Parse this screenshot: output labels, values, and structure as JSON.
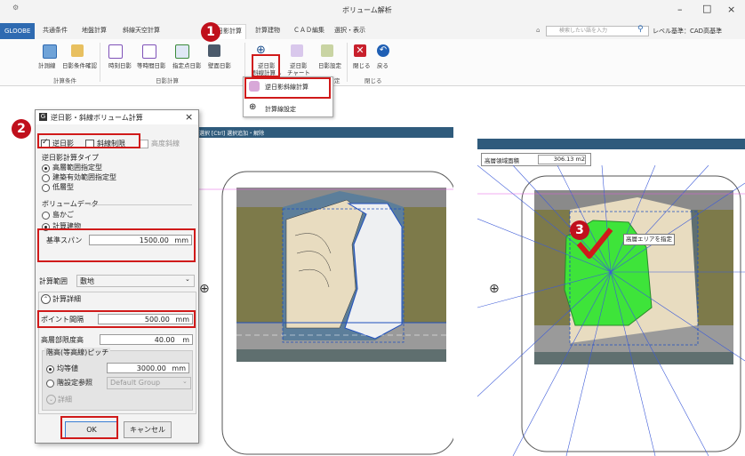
{
  "window": {
    "title": "ボリューム解析",
    "minimize": "–",
    "maximize": "□",
    "close": "×"
  },
  "tabs": [
    "GLOOBE",
    "共通条件",
    "地盤計算",
    "斜線天空計算",
    "日影計算",
    "計算建物",
    "ＣＡＤ編集",
    "選択・表示"
  ],
  "search": {
    "placeholder": "検索したい語を入力"
  },
  "level_label": "レベル基準：CAD高基準",
  "ribbon": {
    "buttons": [
      {
        "label": "計測線",
        "sub": "⌄"
      },
      {
        "label": "日影条件確認",
        "sub": ""
      },
      {
        "label": "時刻日影",
        "sub": ""
      },
      {
        "label": "等時間日影",
        "sub": ""
      },
      {
        "label": "指定点日影",
        "sub": ""
      },
      {
        "label": "壁面日影",
        "sub": "⌄"
      },
      {
        "label": "逆日影",
        "sub": "斜線計算 ⌄"
      },
      {
        "label": "逆日影",
        "sub": "チャート"
      },
      {
        "label": "日影設定",
        "sub": ""
      },
      {
        "label": "閉じる",
        "sub": ""
      },
      {
        "label": "戻る",
        "sub": ""
      }
    ],
    "groups": [
      "計算条件",
      "日影計算",
      "定",
      "閉じる"
    ]
  },
  "dropdown": {
    "items": [
      "逆日影斜線計算",
      "計算線設定"
    ]
  },
  "canvas_hint": "選択 [Ctrl] 選択追加・解除",
  "area_readout": {
    "label": "高層領域面積",
    "value": "306.13",
    "unit": "m2"
  },
  "callout": "高層エリアを指定",
  "badges": [
    "1",
    "2",
    "3"
  ],
  "dialog": {
    "title": "逆日影・斜線ボリューム計算",
    "close": "×",
    "checks": [
      {
        "label": "逆日影",
        "checked": true
      },
      {
        "label": "斜線制限",
        "checked": false
      },
      {
        "label": "高度斜線",
        "checked": false
      }
    ],
    "calc_type": {
      "legend": "逆日影計算タイプ",
      "options": [
        "高層範囲指定型",
        "建築有効範囲指定型",
        "低層型"
      ],
      "selected": 0
    },
    "volume": {
      "legend": "ボリュームデータ",
      "options": [
        "島かご",
        "計算建物"
      ],
      "selected": 1,
      "span_label": "基準スパン",
      "span_value": "1500.00",
      "span_unit": "mm"
    },
    "range": {
      "label": "計算範囲",
      "value": "敷地"
    },
    "detail": {
      "header": "計算詳細",
      "point_label": "ポイント間隔",
      "point_value": "500.00",
      "point_unit": "mm",
      "limit_label": "高層部限度高",
      "limit_value": "40.00",
      "limit_unit": "m",
      "pitch_legend": "階高(等高線)ピッチ",
      "pitch_options": [
        "均等値",
        "階設定参照"
      ],
      "pitch_selected": 0,
      "pitch_value": "3000.00",
      "pitch_unit": "mm",
      "group_value": "Default Group",
      "more": "詳細"
    },
    "ok": "OK",
    "cancel": "キャンセル"
  },
  "colors": {
    "brand": "#2e6ab1",
    "highlight": "#d01a1a",
    "green": "#3ee43a",
    "olive": "#7a7a48",
    "gray": "#8e8e8e"
  }
}
